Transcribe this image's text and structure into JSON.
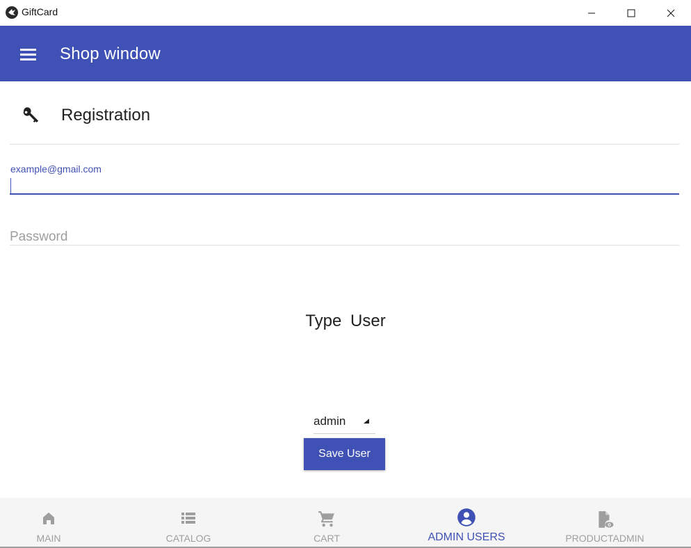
{
  "window": {
    "title": "GiftCard"
  },
  "appbar": {
    "title": "Shop window",
    "menu_icon": "menu-icon",
    "color": "#3f51b5"
  },
  "registration": {
    "title": "Registration",
    "icon": "key-icon"
  },
  "form": {
    "email": {
      "label": "example@gmail.com",
      "value": ""
    },
    "password": {
      "placeholder": "Password",
      "value": ""
    },
    "type_user_title": "Type  User",
    "user_type": {
      "selected": "admin"
    },
    "save_button": "Save User"
  },
  "bottom_nav": {
    "items": [
      {
        "label": "MAIN",
        "icon": "home-icon",
        "active": false
      },
      {
        "label": "CATALOG",
        "icon": "list-icon",
        "active": false
      },
      {
        "label": "CART",
        "icon": "cart-icon",
        "active": false
      },
      {
        "label": "ADMIN USERS",
        "icon": "account-circle-icon",
        "active": true
      },
      {
        "label": "PRODUCTADMIN",
        "icon": "file-eye-icon",
        "active": false
      }
    ]
  },
  "colors": {
    "primary": "#3f51b5",
    "inactive": "#9e9e9e"
  }
}
